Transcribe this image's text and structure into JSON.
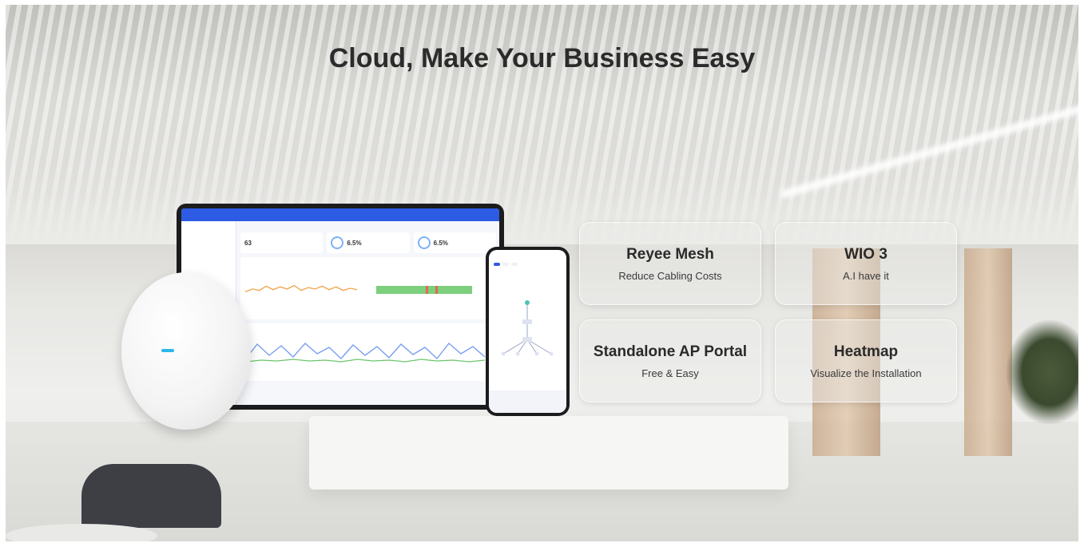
{
  "headline": "Cloud, Make Your Business Easy",
  "features": [
    {
      "title": "Reyee Mesh",
      "subtitle": "Reduce Cabling Costs"
    },
    {
      "title": "WIO 3",
      "subtitle": "A.I have it"
    },
    {
      "title": "Standalone AP Portal",
      "subtitle": "Free & Easy"
    },
    {
      "title": "Heatmap",
      "subtitle": "Visualize the Installation"
    }
  ],
  "laptop": {
    "stats": [
      "63",
      "6.5%",
      "6.5%"
    ]
  },
  "colors": {
    "headline": "#2b2b2b",
    "app_bar": "#2d5be3",
    "led": "#2bb7e8"
  }
}
